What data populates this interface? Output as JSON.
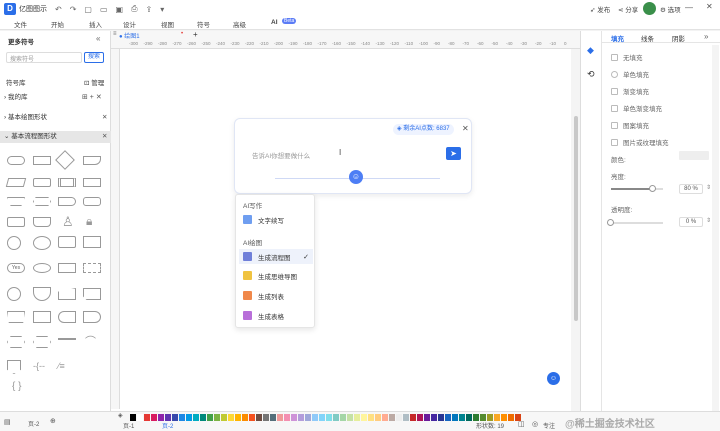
{
  "app": {
    "name": "亿图图示"
  },
  "titlebar": {
    "publish": "发布",
    "share": "分享",
    "options": "选项"
  },
  "menu": [
    "文件",
    "开始",
    "插入",
    "设计",
    "视图",
    "符号",
    "高级",
    "AI"
  ],
  "ai_badge": "Beta",
  "left": {
    "title": "更多符号",
    "search_placeholder": "搜索符号",
    "search_button": "搜索",
    "symbol_lib": "符号库",
    "manage": "管理",
    "my_lib": "我的库",
    "lib1": "基本绘图形状",
    "lib2": "基本流程图形状",
    "yes_label": "Yes"
  },
  "canvas": {
    "tab": "绘图1"
  },
  "ruler": [
    "-300",
    "-290",
    "-280",
    "-270",
    "-260",
    "-250",
    "-240",
    "-230",
    "-220",
    "-210",
    "-200",
    "-190",
    "-180",
    "-170",
    "-160",
    "-150",
    "-140",
    "-130",
    "-120",
    "-110",
    "-100",
    "-90",
    "-80",
    "-70",
    "-60",
    "-50",
    "-40",
    "-30",
    "-20",
    "-10",
    "0"
  ],
  "ai": {
    "credits": "剩余AI点数: 6837",
    "placeholder": "告诉AI你想要做什么",
    "write_section": "AI写作",
    "write_item": "文字续写",
    "draw_section": "AI绘图",
    "items": [
      "生成流程图",
      "生成思维导图",
      "生成列表",
      "生成表格"
    ],
    "icon_colors": [
      "#6f7fd9",
      "#f0c341",
      "#f0884a",
      "#b86fd9"
    ]
  },
  "right": {
    "tabs": [
      "填充",
      "线条",
      "阴影"
    ],
    "options": [
      "无填充",
      "单色填充",
      "渐变填充",
      "单色渐变填充",
      "图案填充",
      "图片或纹理填充"
    ],
    "color_label": "颜色:",
    "brightness_label": "亮度:",
    "brightness_value": "80 %",
    "brightness": 0.8,
    "transparency_label": "透明度:",
    "transparency_value": "0 %",
    "transparency": 0
  },
  "status": {
    "page_sel": "页-2",
    "page1": "页-1",
    "page2": "页-2",
    "shape_count": "形状数: 19",
    "focus": "专注",
    "zoom": "100%"
  },
  "watermark": "@稀土掘金技术社区",
  "palette": [
    "#000",
    "#fff",
    "#e53935",
    "#d81b60",
    "#8e24aa",
    "#5e35b1",
    "#3949ab",
    "#1e88e5",
    "#039be5",
    "#00acc1",
    "#00897b",
    "#43a047",
    "#7cb342",
    "#c0ca33",
    "#fdd835",
    "#ffb300",
    "#fb8c00",
    "#f4511e",
    "#6d4c41",
    "#757575",
    "#546e7a",
    "#ef9a9a",
    "#f48fb1",
    "#ce93d8",
    "#b39ddb",
    "#9fa8da",
    "#90caf9",
    "#81d4fa",
    "#80deea",
    "#80cbc4",
    "#a5d6a7",
    "#c5e1a5",
    "#e6ee9c",
    "#fff59d",
    "#ffe082",
    "#ffcc80",
    "#ffab91",
    "#bcaaa4",
    "#eeeeee",
    "#b0bec5",
    "#c62828",
    "#ad1457",
    "#6a1b9a",
    "#4527a0",
    "#283593",
    "#1565c0",
    "#0277bd",
    "#00838f",
    "#00695c",
    "#2e7d32",
    "#558b2f",
    "#9e9d24",
    "#f9a825",
    "#ff8f00",
    "#ef6c00",
    "#d84315"
  ]
}
